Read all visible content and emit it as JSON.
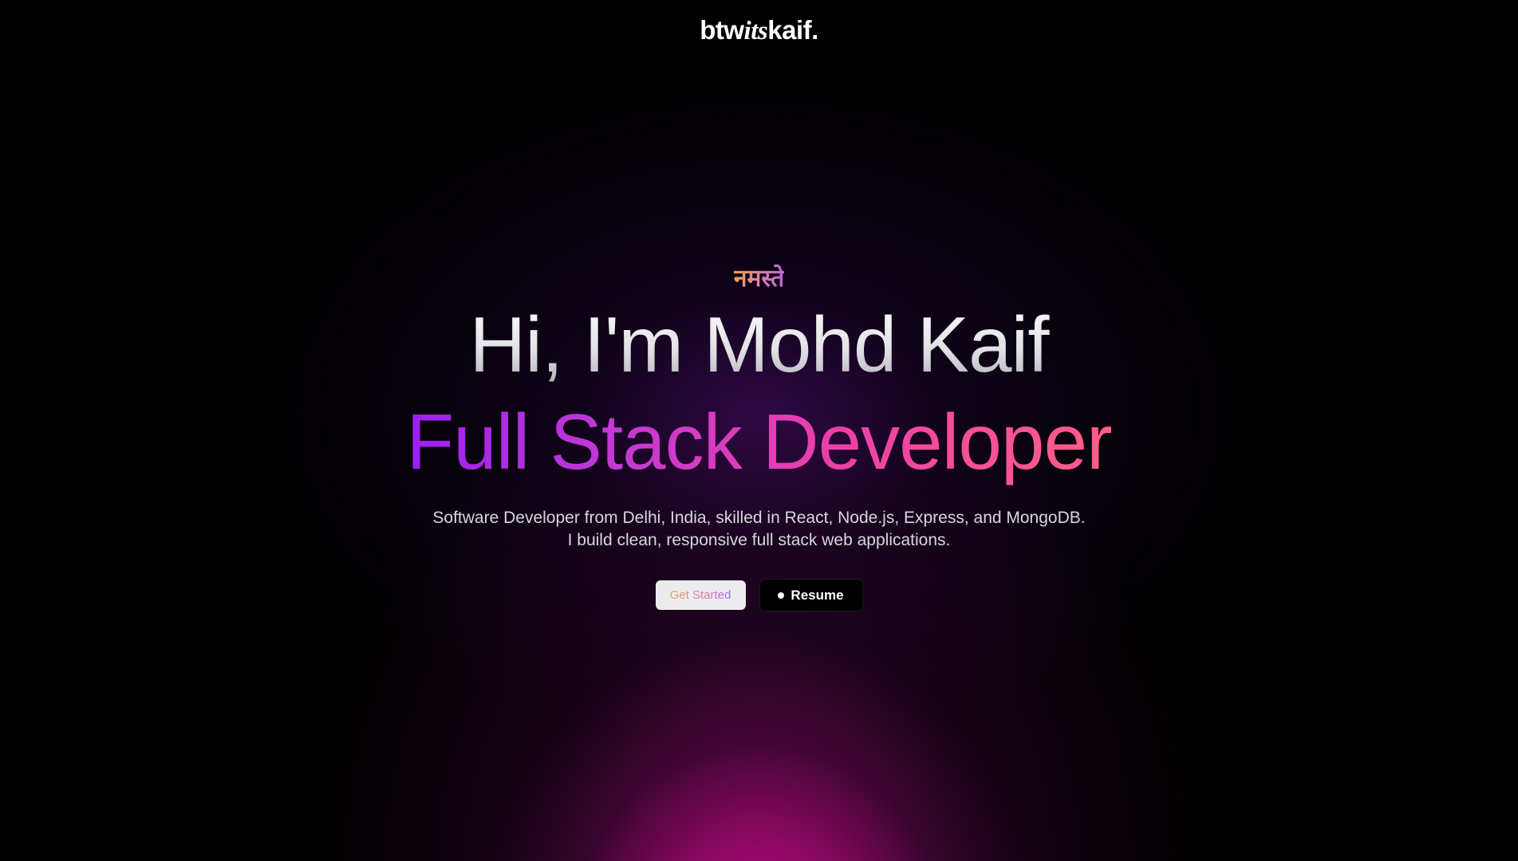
{
  "header": {
    "logo_pre": "btw",
    "logo_mid": "its",
    "logo_post": "kaif."
  },
  "hero": {
    "greeting": "नमस्ते",
    "name": "Hi, I'm Mohd Kaif",
    "role": "Full Stack Developer",
    "description_line1": "Software Developer from Delhi, India, skilled in React, Node.js, Express, and MongoDB.",
    "description_line2": "I build clean, responsive full stack web applications.",
    "primary_button": "Get Started",
    "secondary_button": "Resume",
    "secondary_button_icon": "dot-icon"
  },
  "colors": {
    "background": "#000000",
    "glow": "#d60e8c",
    "role_gradient_start": "#9b1ff2",
    "role_gradient_end": "#ff5f86",
    "greeting_gradient_start": "#f4a24a"
  }
}
